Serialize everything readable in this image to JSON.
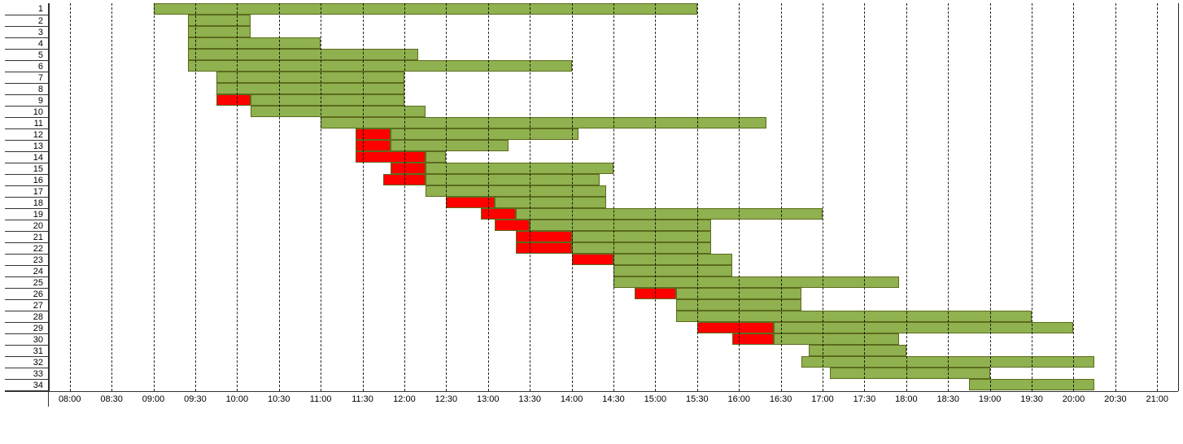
{
  "chart_data": {
    "type": "gantt",
    "x_axis": {
      "min": "07:45",
      "max": "21:15",
      "ticks": [
        "08:00",
        "08:30",
        "09:00",
        "09:30",
        "10:00",
        "10:30",
        "11:00",
        "11:30",
        "12:00",
        "12:30",
        "13:00",
        "13:30",
        "14:00",
        "14:30",
        "15:00",
        "15:30",
        "16:00",
        "16:30",
        "17:00",
        "17:30",
        "18:00",
        "18:30",
        "19:00",
        "19:30",
        "20:00",
        "20:30",
        "21:00"
      ]
    },
    "row_labels": [
      "1",
      "2",
      "3",
      "4",
      "5",
      "6",
      "7",
      "8",
      "9",
      "10",
      "11",
      "12",
      "13",
      "14",
      "15",
      "16",
      "17",
      "18",
      "19",
      "20",
      "21",
      "22",
      "23",
      "24",
      "25",
      "26",
      "27",
      "28",
      "29",
      "30",
      "31",
      "32",
      "33",
      "34"
    ],
    "rows": [
      {
        "row": 1,
        "red_start": null,
        "green_start": "09:00",
        "green_end": "15:30"
      },
      {
        "row": 2,
        "red_start": null,
        "green_start": "09:25",
        "green_end": "10:10"
      },
      {
        "row": 3,
        "red_start": null,
        "green_start": "09:25",
        "green_end": "10:10"
      },
      {
        "row": 4,
        "red_start": null,
        "green_start": "09:25",
        "green_end": "11:00"
      },
      {
        "row": 5,
        "red_start": null,
        "green_start": "09:25",
        "green_end": "12:10"
      },
      {
        "row": 6,
        "red_start": null,
        "green_start": "09:25",
        "green_end": "14:00"
      },
      {
        "row": 7,
        "red_start": null,
        "green_start": "09:45",
        "green_end": "12:00"
      },
      {
        "row": 8,
        "red_start": null,
        "green_start": "09:45",
        "green_end": "12:00"
      },
      {
        "row": 9,
        "red_start": "09:45",
        "green_start": "10:10",
        "green_end": "12:00"
      },
      {
        "row": 10,
        "red_start": null,
        "green_start": "10:10",
        "green_end": "12:15"
      },
      {
        "row": 11,
        "red_start": null,
        "green_start": "11:00",
        "green_end": "16:20"
      },
      {
        "row": 12,
        "red_start": "11:25",
        "green_start": "11:50",
        "green_end": "14:05"
      },
      {
        "row": 13,
        "red_start": "11:25",
        "green_start": "11:50",
        "green_end": "13:15"
      },
      {
        "row": 14,
        "red_start": "11:25",
        "green_start": "12:15",
        "green_end": "12:30"
      },
      {
        "row": 15,
        "red_start": "11:50",
        "green_start": "12:15",
        "green_end": "14:30"
      },
      {
        "row": 16,
        "red_start": "11:45",
        "green_start": "12:15",
        "green_end": "14:20"
      },
      {
        "row": 17,
        "red_start": null,
        "green_start": "12:15",
        "green_end": "14:25"
      },
      {
        "row": 18,
        "red_start": "12:30",
        "green_start": "13:05",
        "green_end": "14:25"
      },
      {
        "row": 19,
        "red_start": "12:55",
        "green_start": "13:20",
        "green_end": "17:00"
      },
      {
        "row": 20,
        "red_start": "13:05",
        "green_start": "13:30",
        "green_end": "15:40"
      },
      {
        "row": 21,
        "red_start": "13:20",
        "green_start": "14:00",
        "green_end": "15:40"
      },
      {
        "row": 22,
        "red_start": "13:20",
        "green_start": "14:00",
        "green_end": "15:40"
      },
      {
        "row": 23,
        "red_start": "14:00",
        "green_start": "14:30",
        "green_end": "15:55"
      },
      {
        "row": 24,
        "red_start": null,
        "green_start": "14:30",
        "green_end": "15:55"
      },
      {
        "row": 25,
        "red_start": null,
        "green_start": "14:30",
        "green_end": "17:55"
      },
      {
        "row": 26,
        "red_start": "14:45",
        "green_start": "15:15",
        "green_end": "16:45"
      },
      {
        "row": 27,
        "red_start": null,
        "green_start": "15:15",
        "green_end": "16:45"
      },
      {
        "row": 28,
        "red_start": null,
        "green_start": "15:15",
        "green_end": "19:30"
      },
      {
        "row": 29,
        "red_start": "15:30",
        "green_start": "16:25",
        "green_end": "20:00"
      },
      {
        "row": 30,
        "red_start": "15:55",
        "green_start": "16:25",
        "green_end": "17:55"
      },
      {
        "row": 31,
        "red_start": null,
        "green_start": "16:50",
        "green_end": "18:00"
      },
      {
        "row": 32,
        "red_start": null,
        "green_start": "16:45",
        "green_end": "20:15"
      },
      {
        "row": 33,
        "red_start": null,
        "green_start": "17:05",
        "green_end": "19:00"
      },
      {
        "row": 34,
        "red_start": null,
        "green_start": "18:45",
        "green_end": "20:15"
      }
    ]
  },
  "colors": {
    "green": "#8fb14f",
    "red": "#ff0000",
    "border": "#5c6b1e"
  }
}
